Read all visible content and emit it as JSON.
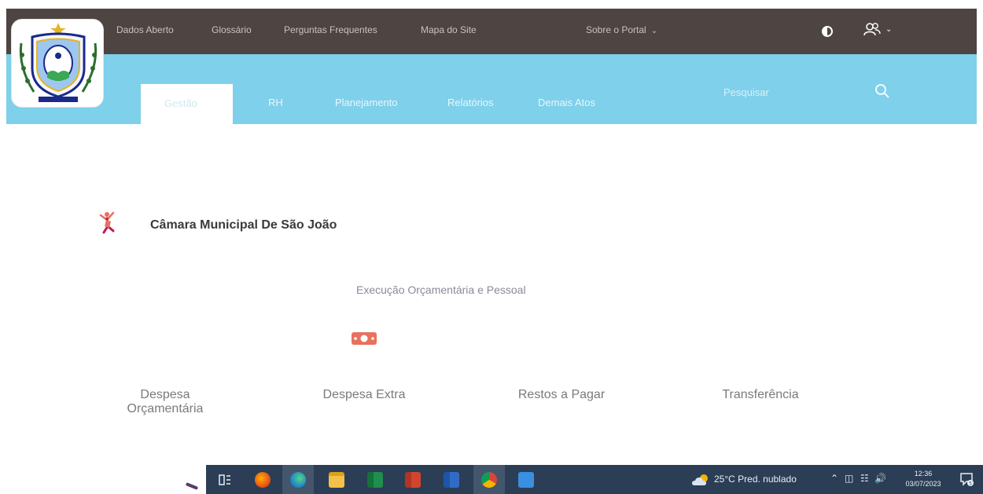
{
  "header": {
    "nav_links": [
      "Dados Aberto",
      "Glossário",
      "Perguntas Frequentes",
      "Mapa do Site"
    ],
    "about_menu": "Sobre o Portal",
    "contrast_icon": "contrast-icon",
    "user_icon": "users-icon"
  },
  "tabs": [
    {
      "label": "Gestão",
      "active": true
    },
    {
      "label": "RH",
      "active": false
    },
    {
      "label": "Planejamento",
      "active": false
    },
    {
      "label": "Relatórios",
      "active": false
    },
    {
      "label": "Demais Atos",
      "active": false
    }
  ],
  "search": {
    "placeholder": "Pesquisar"
  },
  "organization": {
    "name": "Câmara Municipal De São João",
    "icon": "dancer-icon"
  },
  "section": {
    "title": "Execução Orçamentária e Pessoal",
    "icon": "money-icon",
    "cards": [
      "Despesa Orçamentária",
      "Despesa Extra",
      "Restos a Pagar",
      "Transferência"
    ]
  },
  "taskbar": {
    "apps": [
      "task-view-icon",
      "firefox-icon",
      "edge-icon",
      "file-explorer-icon",
      "excel-icon",
      "powerpoint-icon",
      "word-icon",
      "chrome-icon",
      "app-icon"
    ],
    "weather": "25°C  Pred. nublado",
    "time": "12:36",
    "date": "03/07/2023",
    "notification_count": "5"
  },
  "colors": {
    "topbar": "#4e4442",
    "bluebar": "#7fd0ea",
    "taskbar": "#2b3e55",
    "accent_icon": "#e8715e"
  }
}
